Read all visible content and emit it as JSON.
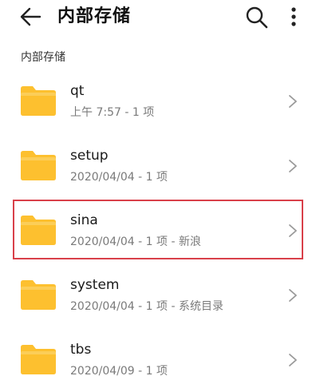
{
  "header": {
    "title": "内部存储",
    "back_icon": "back-arrow-icon",
    "search_icon": "search-icon",
    "more_icon": "more-vertical-icon"
  },
  "breadcrumb": {
    "label": "内部存储"
  },
  "folders": [
    {
      "name": "qt",
      "meta": "上午 7:57 - 1 项",
      "icon": "folder-icon"
    },
    {
      "name": "setup",
      "meta": "2020/04/04 - 1 项",
      "icon": "folder-icon"
    },
    {
      "name": "sina",
      "meta": "2020/04/04 - 1 项 - 新浪",
      "icon": "folder-icon",
      "highlighted": true
    },
    {
      "name": "system",
      "meta": "2020/04/04 - 1 项 - 系统目录",
      "icon": "folder-icon"
    },
    {
      "name": "tbs",
      "meta": "2020/04/09 - 1 项",
      "icon": "folder-icon"
    }
  ],
  "colors": {
    "folder": "#fdc02f",
    "folder_tab": "#fbd46a",
    "highlight": "#d9404a",
    "meta_text": "#7a7a7a",
    "chevron": "#9a9a9a"
  }
}
